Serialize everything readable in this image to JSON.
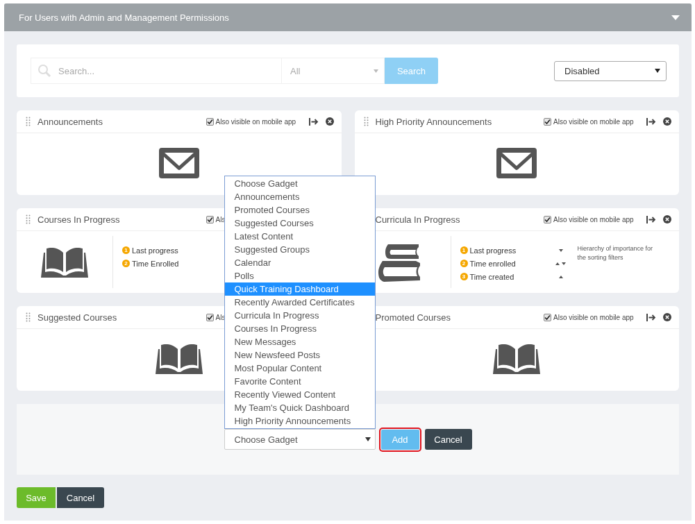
{
  "header": {
    "title": "For Users with Admin and Management Permissions"
  },
  "search": {
    "placeholder": "Search...",
    "category": "All",
    "button": "Search",
    "status": "Disabled"
  },
  "gadgets": [
    {
      "title": "Announcements",
      "mobile_label": "Also visible on mobile app",
      "mobile_checked": true,
      "show_handle": true,
      "show_actions": true,
      "kind": "envelope"
    },
    {
      "title": "High Priority Announcements",
      "mobile_label": "Also visible on mobile app",
      "mobile_checked": true,
      "show_handle": true,
      "show_actions": true,
      "kind": "envelope"
    },
    {
      "title": "Courses In Progress",
      "mobile_label": "Als",
      "mobile_checked": true,
      "show_handle": true,
      "show_actions": false,
      "kind": "book",
      "sort_arrows": false,
      "sort_items": [
        {
          "number": "1",
          "label": "Last progress"
        },
        {
          "number": "2",
          "label": "Time Enrolled"
        }
      ]
    },
    {
      "title": "Curricula In Progress",
      "mobile_label": "Also visible on mobile app",
      "mobile_checked": true,
      "show_handle": false,
      "show_actions": true,
      "kind": "books",
      "sort_arrows": true,
      "sort_items": [
        {
          "number": "1",
          "label": "Last progress"
        },
        {
          "number": "2",
          "label": "Time enrolled"
        },
        {
          "number": "3",
          "label": "Time created"
        }
      ],
      "hint": "Hierarchy of importance for the sorting filters"
    },
    {
      "title": "Suggested Courses",
      "mobile_label": "Als",
      "mobile_checked": true,
      "show_handle": true,
      "show_actions": false,
      "kind": "book"
    },
    {
      "title": "Promoted Courses",
      "mobile_label": "Also visible on mobile app",
      "mobile_checked": true,
      "show_handle": false,
      "show_actions": true,
      "kind": "book"
    }
  ],
  "add_panel": {
    "select_value": "Choose Gadget",
    "options": [
      {
        "label": "Choose Gadget",
        "selected": false
      },
      {
        "label": "Announcements",
        "selected": false
      },
      {
        "label": "Promoted Courses",
        "selected": false
      },
      {
        "label": "Suggested Courses",
        "selected": false
      },
      {
        "label": "Latest Content",
        "selected": false
      },
      {
        "label": "Suggested Groups",
        "selected": false
      },
      {
        "label": "Calendar",
        "selected": false
      },
      {
        "label": "Polls",
        "selected": false
      },
      {
        "label": "Quick Training Dashboard",
        "selected": true
      },
      {
        "label": "Recently Awarded Certificates",
        "selected": false
      },
      {
        "label": "Curricula In Progress",
        "selected": false
      },
      {
        "label": "Courses In Progress",
        "selected": false
      },
      {
        "label": "New Messages",
        "selected": false
      },
      {
        "label": "New Newsfeed Posts",
        "selected": false
      },
      {
        "label": "Most Popular Content",
        "selected": false
      },
      {
        "label": "Favorite Content",
        "selected": false
      },
      {
        "label": "Recently Viewed Content",
        "selected": false
      },
      {
        "label": "My Team's Quick Dashboard",
        "selected": false
      },
      {
        "label": "High Priority Announcements",
        "selected": false
      }
    ],
    "add_button": "Add",
    "add_focused": true,
    "cancel_button": "Cancel"
  },
  "footer": {
    "save": "Save",
    "cancel": "Cancel"
  }
}
